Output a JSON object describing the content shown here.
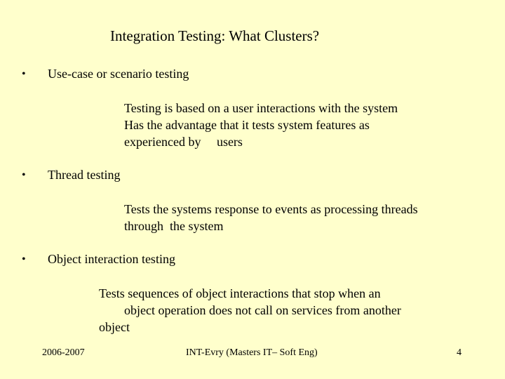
{
  "slide": {
    "title": "Integration Testing: What Clusters?",
    "bullets": [
      {
        "symbol": "•",
        "label": "Use-case or scenario testing",
        "details": [
          "Testing is based on a user interactions with the system",
          "Has the advantage that it tests system features as",
          "experienced by     users"
        ]
      },
      {
        "symbol": "•",
        "label": "Thread testing",
        "details": [
          "Tests the systems response to events as processing threads",
          "through  the system"
        ]
      },
      {
        "symbol": "•",
        "label": "Object interaction testing",
        "details": [
          "Tests sequences of object interactions that stop when an",
          "object operation does not call on services from another",
          "object"
        ]
      }
    ]
  },
  "footer": {
    "date": "2006-2007",
    "center": "INT-Evry (Masters IT– Soft Eng)",
    "page_number": "4"
  },
  "colors": {
    "background": "#ffffcc",
    "text": "#000000"
  }
}
